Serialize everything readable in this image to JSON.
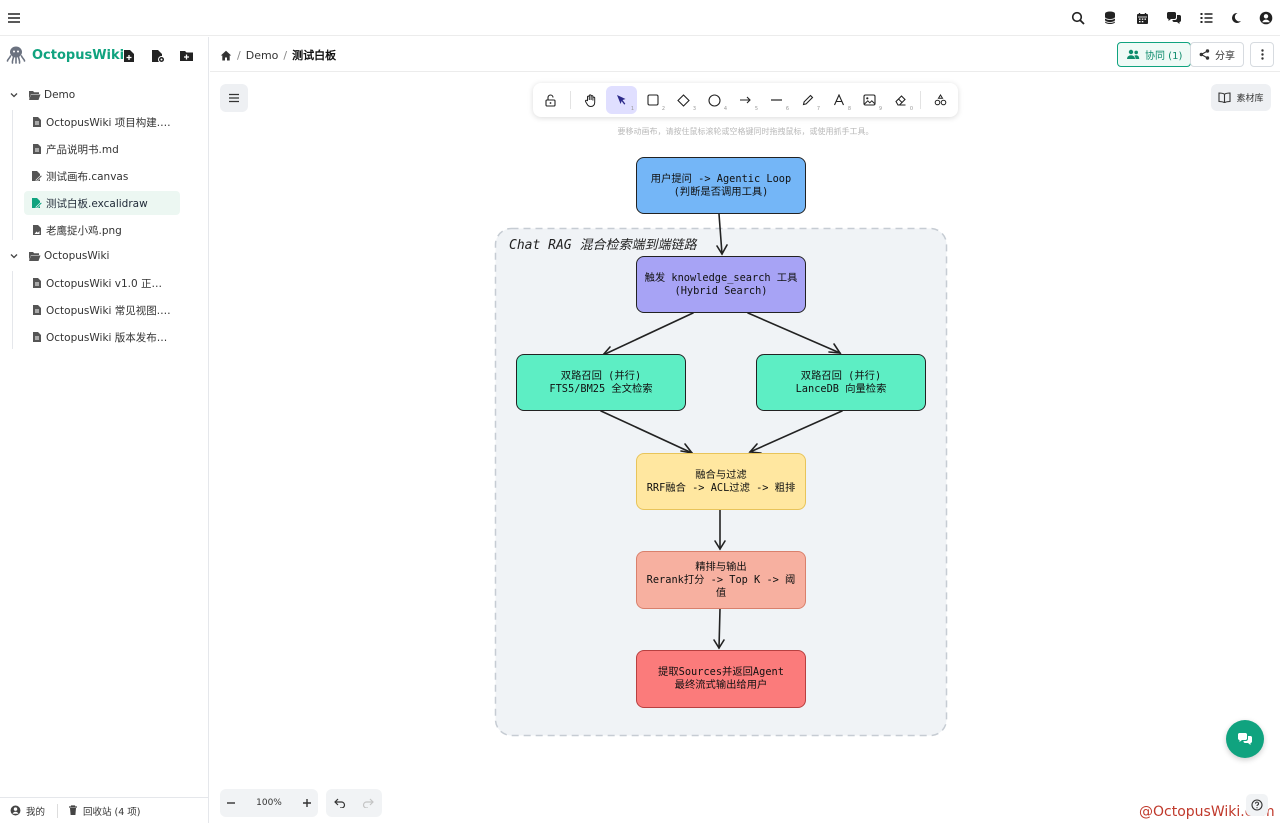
{
  "app": {
    "name": "OctopusWiki"
  },
  "tree": [
    {
      "type": "folder",
      "label": "Demo",
      "level": 0
    },
    {
      "type": "file",
      "icon": "file-icon",
      "label": "OctopusWiki 项目构建.b...",
      "level": 1
    },
    {
      "type": "file",
      "icon": "file-icon",
      "label": "产品说明书.md",
      "level": 1
    },
    {
      "type": "file",
      "icon": "canvas-icon",
      "label": "测试画布.canvas",
      "level": 1
    },
    {
      "type": "file",
      "icon": "drawing-icon",
      "label": "测试白板.excalidraw",
      "level": 1,
      "active": true
    },
    {
      "type": "file",
      "icon": "image-icon",
      "label": "老鹰捉小鸡.png",
      "level": 1
    },
    {
      "type": "folder",
      "label": "OctopusWiki",
      "level": 0
    },
    {
      "type": "file",
      "icon": "file-icon",
      "label": "OctopusWiki v1.0 正式版...",
      "level": 1
    },
    {
      "type": "file",
      "icon": "file-icon",
      "label": "OctopusWiki 常见视图.md",
      "level": 1
    },
    {
      "type": "file",
      "icon": "file-icon",
      "label": "OctopusWiki 版本发布说...",
      "level": 1
    }
  ],
  "footer": {
    "mine": "我的",
    "trash": "回收站 (4 项)"
  },
  "breadcrumb": {
    "folder": "Demo",
    "page": "测试白板"
  },
  "header": {
    "collab": "协同 (1)",
    "share": "分享"
  },
  "canvas": {
    "library": "素材库",
    "hint": "要移动画布，请按住鼠标滚轮或空格键同时拖拽鼠标，或使用抓手工具。",
    "zoom": "100%",
    "group_title": "Chat RAG 混合检索端到端链路",
    "nodes": [
      {
        "line1": "用户提问 -> Agentic Loop",
        "line2": "(判断是否调用工具)",
        "line3": "",
        "color": "#74b6f7"
      },
      {
        "line1": "触发 knowledge_search 工具",
        "line2": "(Hybrid Search)",
        "line3": "",
        "color": "#a7a3f5"
      },
      {
        "line1": "双路召回 (并行)",
        "line2": "FTS5/BM25 全文检索",
        "line3": "",
        "color": "#5deec4"
      },
      {
        "line1": "双路召回 (并行)",
        "line2": "LanceDB 向量检索",
        "line3": "",
        "color": "#5deec4"
      },
      {
        "line1": "融合与过滤",
        "line2": "RRF融合 -> ACL过滤 -> 粗排",
        "line3": "",
        "color": "#ffe7a0"
      },
      {
        "line1": "精排与输出",
        "line2": "Rerank打分 -> Top K -> 阈",
        "line3": "值",
        "color": "#f7b0a0"
      },
      {
        "line1": "提取Sources并返回Agent",
        "line2": "最终流式输出给用户",
        "line3": "",
        "color": "#fb7b7b"
      }
    ]
  },
  "watermark": "@OctopusWiki.com",
  "colors": {
    "brand": "#10a37f",
    "toolbar_selected": "#e0dfff",
    "fab": "#10a37f"
  }
}
